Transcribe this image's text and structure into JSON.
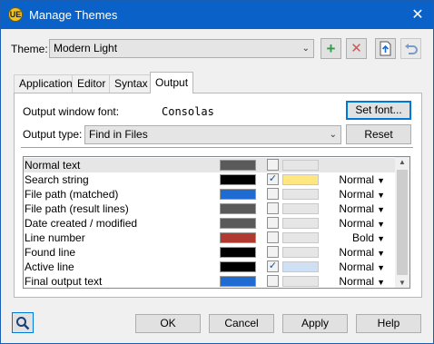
{
  "window": {
    "title": "Manage Themes",
    "app_icon_text": "UE",
    "close_glyph": "✕"
  },
  "theme": {
    "label": "Theme:",
    "value": "Modern Light",
    "arrow": "⌄",
    "add_glyph": "+",
    "delete_glyph": "✕",
    "accent_add": "#2e9d48",
    "accent_delete": "#d9534f"
  },
  "tabs": [
    {
      "label": "Application"
    },
    {
      "label": "Editor"
    },
    {
      "label": "Syntax"
    },
    {
      "label": "Output",
      "active": true
    }
  ],
  "output": {
    "font_label": "Output window font:",
    "font_value": "Consolas",
    "set_font_button": "Set font...",
    "type_label": "Output type:",
    "type_value": "Find in Files",
    "reset_button": "Reset"
  },
  "rows": [
    {
      "name": "Normal text",
      "fg": "#5a5a5a",
      "bg": "#e6e6e6",
      "checked": false,
      "style": "",
      "selected": true
    },
    {
      "name": "Search string",
      "fg": "#000000",
      "bg": "#ffe680",
      "checked": true,
      "style": "Normal"
    },
    {
      "name": "File path (matched)",
      "fg": "#1f6bd1",
      "bg": "#e6e6e6",
      "checked": false,
      "style": "Normal"
    },
    {
      "name": "File path (result lines)",
      "fg": "#5a5a5a",
      "bg": "#e6e6e6",
      "checked": false,
      "style": "Normal"
    },
    {
      "name": "Date created / modified",
      "fg": "#5a5a5a",
      "bg": "#e6e6e6",
      "checked": false,
      "style": "Normal"
    },
    {
      "name": "Line number",
      "fg": "#b03a30",
      "bg": "#e6e6e6",
      "checked": false,
      "style": "Bold"
    },
    {
      "name": "Found line",
      "fg": "#000000",
      "bg": "#e6e6e6",
      "checked": false,
      "style": "Normal"
    },
    {
      "name": "Active line",
      "fg": "#000000",
      "bg": "#cfe0f5",
      "checked": true,
      "style": "Normal"
    },
    {
      "name": "Final output text",
      "fg": "#1f6bd1",
      "bg": "#e6e6e6",
      "checked": false,
      "style": "Normal"
    }
  ],
  "check_glyph": "✓",
  "style_arrow": "▼",
  "footer": {
    "search_icon": "magnifier-icon",
    "ok": "OK",
    "cancel": "Cancel",
    "apply": "Apply",
    "help": "Help"
  }
}
